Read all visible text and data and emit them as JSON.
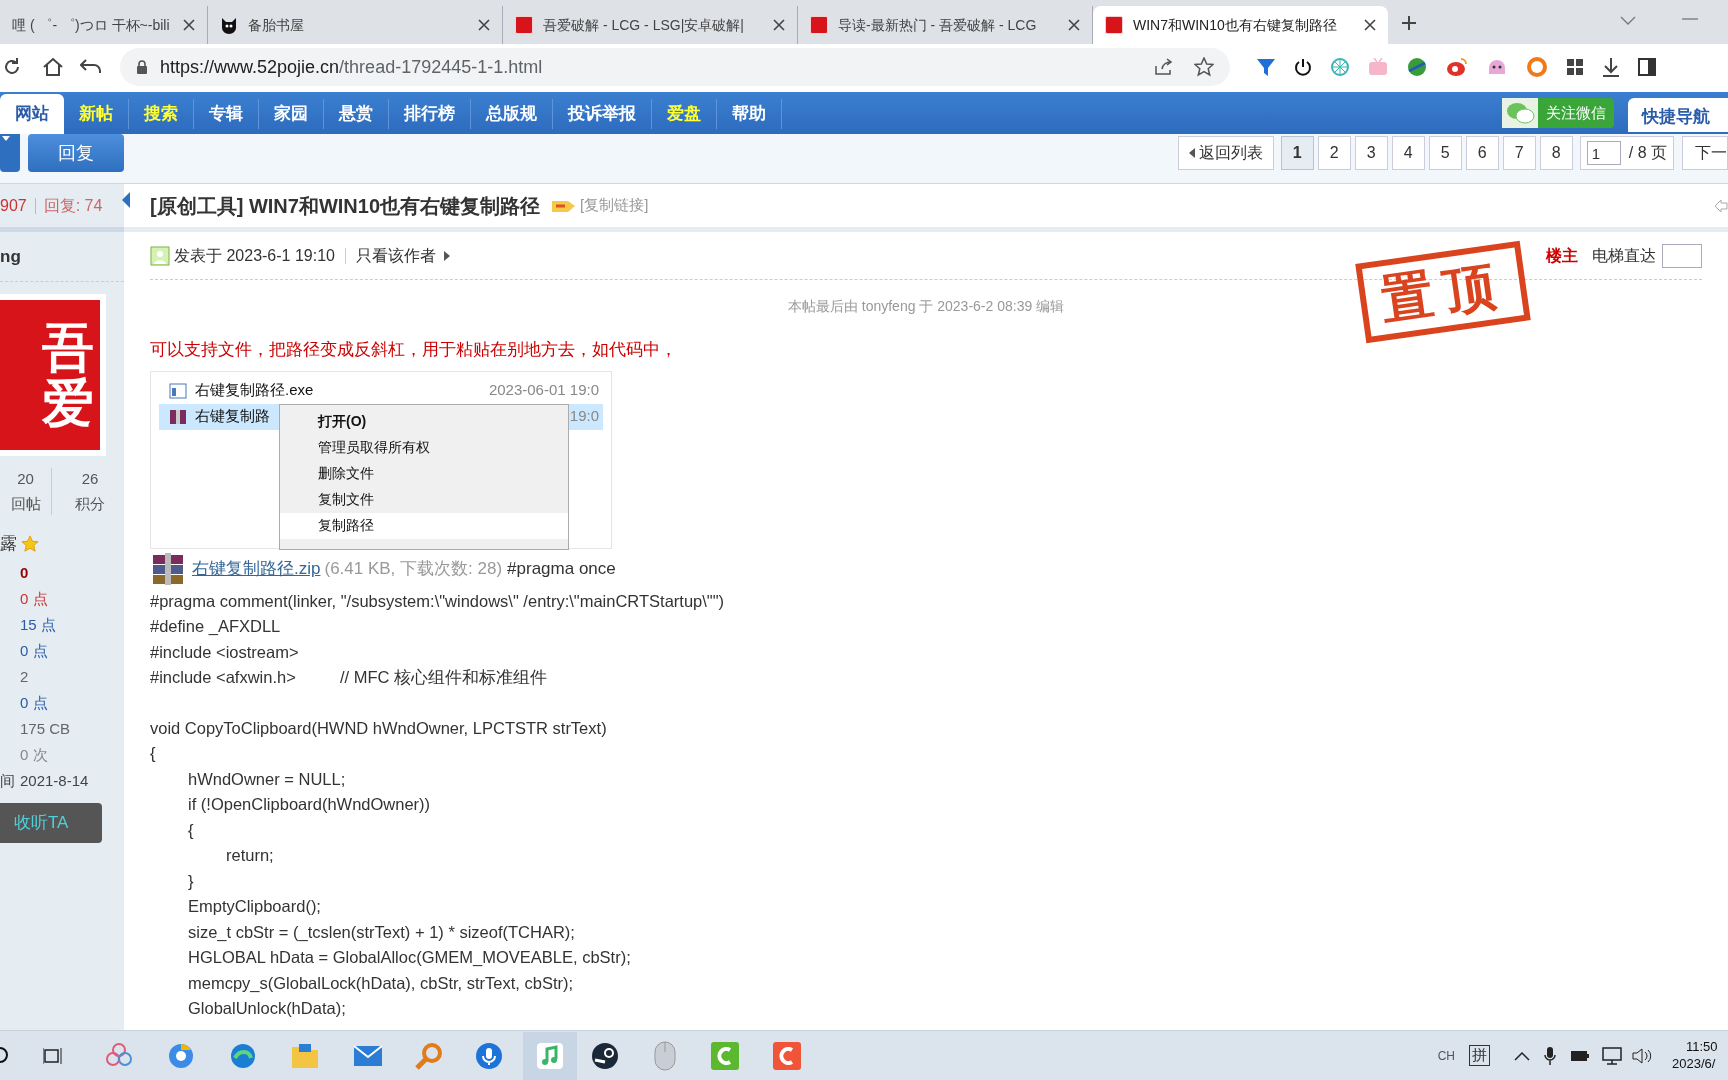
{
  "browser": {
    "tabs": [
      {
        "title": "哩 ( ゜- ゜)つロ 干杯~-bili",
        "kind": "plain",
        "selected": false
      },
      {
        "title": "备胎书屋",
        "kind": "cat",
        "selected": false
      },
      {
        "title": "吾爱破解 - LCG - LSG|安卓破解|",
        "kind": "seal",
        "selected": false
      },
      {
        "title": "导读-最新热门 - 吾爱破解 - LCG",
        "kind": "seal",
        "selected": false
      },
      {
        "title": "WIN7和WIN10也有右键复制路径",
        "kind": "seal",
        "selected": true
      }
    ],
    "url_host": "https://www.52pojie.cn",
    "url_path": "/thread-1792445-1-1.html"
  },
  "nav": {
    "items": [
      {
        "label": "网站",
        "highlight": false,
        "selected": true
      },
      {
        "label": "新帖",
        "highlight": true,
        "selected": false
      },
      {
        "label": "搜索",
        "highlight": true,
        "selected": false
      },
      {
        "label": "专辑",
        "highlight": false,
        "selected": false
      },
      {
        "label": "家园",
        "highlight": false,
        "selected": false
      },
      {
        "label": "悬赏",
        "highlight": false,
        "selected": false
      },
      {
        "label": "排行榜",
        "highlight": false,
        "selected": false
      },
      {
        "label": "总版规",
        "highlight": false,
        "selected": false
      },
      {
        "label": "投诉举报",
        "highlight": false,
        "selected": false
      },
      {
        "label": "爱盘",
        "highlight": true,
        "selected": false
      },
      {
        "label": "帮助",
        "highlight": false,
        "selected": false
      }
    ],
    "wechat_button": "关注微信",
    "quick_nav": "快捷导航"
  },
  "toolbar": {
    "reply_button": "回复",
    "back_to_list": "返回列表",
    "pages": [
      {
        "label": "1",
        "selected": true
      },
      {
        "label": "2",
        "selected": false
      },
      {
        "label": "3",
        "selected": false
      },
      {
        "label": "4",
        "selected": false
      },
      {
        "label": "5",
        "selected": false
      },
      {
        "label": "6",
        "selected": false
      },
      {
        "label": "7",
        "selected": false
      },
      {
        "label": "8",
        "selected": false
      }
    ],
    "page_input": "1",
    "page_total": "/ 8 页",
    "next": "下一"
  },
  "sidebar": {
    "views": "907",
    "replies": "回复: 74",
    "username": "ng",
    "avatar_chars": [
      "吾",
      "爱"
    ],
    "counts": [
      {
        "value": "20",
        "label": "回帖"
      },
      {
        "value": "26",
        "label": "积分"
      }
    ],
    "rank": "露",
    "rows": [
      {
        "value": "0",
        "color": "#990000"
      },
      {
        "value": "0 点",
        "color": "#cc3333"
      },
      {
        "value": "15 点",
        "color": "#2a5caa"
      },
      {
        "value": "0 点",
        "color": "#2a5caa"
      },
      {
        "value": "2",
        "color": "#666666"
      },
      {
        "value": "0 点",
        "color": "#2a5caa"
      },
      {
        "value": "175 CB",
        "color": "#666666"
      },
      {
        "value": "0 次",
        "color": "#888888"
      },
      {
        "label": "间",
        "value": "2021-8-14",
        "color": "#444444"
      }
    ],
    "follow_button": "收听TA"
  },
  "post": {
    "title": "[原创工具] WIN7和WIN10也有右键复制路径",
    "copy_link": "[复制链接]",
    "posted": "发表于 2023-6-1 19:10",
    "author_only": "只看该作者",
    "stamp": "置顶",
    "floor": "楼主",
    "jump_label": "电梯直达",
    "edit_note": "本帖最后由 tonyfeng 于 2023-6-2 08:39 编辑",
    "intro": "可以支持文件，把路径变成反斜杠，用于粘贴在别地方去，如代码中，",
    "screenshot": {
      "files": [
        {
          "name": "右键复制路径.exe",
          "date": "2023-06-01 19:0",
          "selected": false
        },
        {
          "name": "右键复制路",
          "date": "19:0",
          "selected": true
        }
      ],
      "menu": [
        {
          "label": "打开(O)",
          "default": true,
          "selected": false
        },
        {
          "label": "管理员取得所有权",
          "default": false,
          "selected": false
        },
        {
          "label": "删除文件",
          "default": false,
          "selected": false
        },
        {
          "label": "复制文件",
          "default": false,
          "selected": false
        },
        {
          "label": "复制路径",
          "default": false,
          "selected": true
        }
      ]
    },
    "attachment": {
      "name": "右键复制路径.zip",
      "info": "(6.41 KB, 下载次数: 28)",
      "trailing": "#pragma once"
    },
    "code_blocks": [
      [
        "#pragma comment(linker, \"/subsystem:\\\"windows\\\" /entry:\\\"mainCRTStartup\\\"\")",
        "#define _AFXDLL",
        "#include <iostream>",
        "#include <afxwin.h>\t\t// MFC 核心组件和标准组件"
      ],
      [
        "void CopyToClipboard(HWND hWndOwner, LPCTSTR strText)",
        "{",
        "\thWndOwner = NULL;",
        "\tif (!OpenClipboard(hWndOwner))",
        "\t{",
        "\t\treturn;",
        "\t}",
        "\tEmptyClipboard();",
        "\tsize_t cbStr = (_tcslen(strText) + 1) * sizeof(TCHAR);",
        "\tHGLOBAL hData = GlobalAlloc(GMEM_MOVEABLE, cbStr);",
        "\tmemcpy_s(GlobalLock(hData), cbStr, strText, cbStr);",
        "\tGlobalUnlock(hData);"
      ]
    ]
  },
  "taskbar": {
    "ime_lang": "CH",
    "ime_mode": "拼",
    "time": "11:50",
    "date": "2023/6/"
  }
}
